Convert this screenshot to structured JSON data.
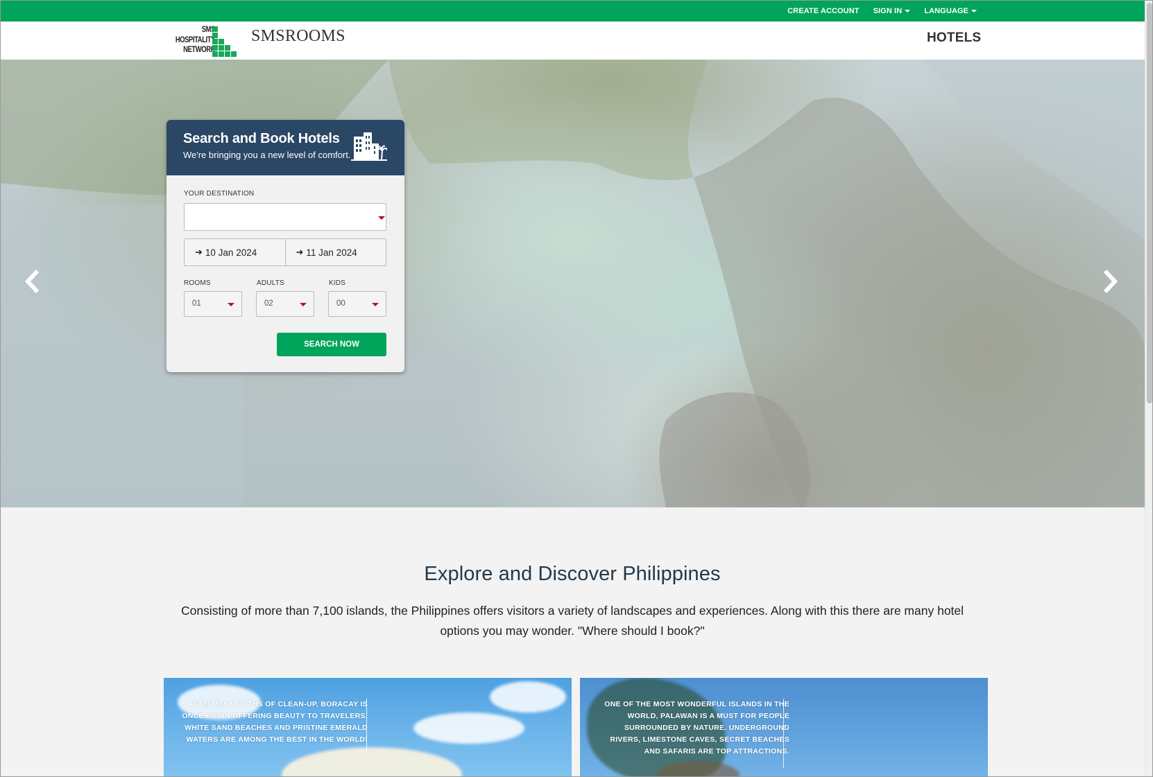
{
  "topbar": {
    "create_account": "CREATE ACCOUNT",
    "sign_in": "SIGN IN",
    "language": "LANGUAGE"
  },
  "header": {
    "logo_text": [
      "SMS",
      "HOSPITALITY",
      "NETWORK"
    ],
    "brand": "SMSROOMS",
    "nav_hotels": "HOTELS"
  },
  "booking": {
    "title": "Search and Book Hotels",
    "subtitle": "We're bringing you a new level of comfort.",
    "destination_label": "YOUR DESTINATION",
    "destination_value": "",
    "checkin": "10 Jan 2024",
    "checkout": "11 Jan 2024",
    "rooms_label": "ROOMS",
    "rooms_value": "01",
    "adults_label": "ADULTS",
    "adults_value": "02",
    "kids_label": "KIDS",
    "kids_value": "00",
    "search_label": "SEARCH NOW"
  },
  "explore": {
    "title": "Explore and Discover Philippines",
    "text": "Consisting of more than 7,100 islands, the Philippines offers visitors a variety of landscapes and experiences. Along with this there are many hotel options you may wonder. \"Where should I book?\""
  },
  "cards": [
    {
      "text": "AFTER SIX MONTHS OF CLEAN-UP, BORACAY IS ONCE AGAIN OFFERING BEAUTY TO TRAVELERS. WHITE SAND BEACHES AND PRISTINE EMERALD WATERS ARE AMONG THE BEST IN THE WORLD!"
    },
    {
      "text": "ONE OF THE MOST WONDERFUL ISLANDS IN THE WORLD, PALAWAN IS A MUST FOR PEOPLE SURROUNDED BY NATURE. UNDERGROUND RIVERS, LIMESTONE CAVES, SECRET BEACHES AND SAFARIS ARE TOP ATTRACTIONS."
    }
  ],
  "colors": {
    "brand_green": "#00a45a",
    "panel_navy": "#2b4766",
    "caret_red": "#b1121f"
  },
  "icons": [
    "caret-down-icon",
    "hotel-building-icon",
    "arrow-right-icon",
    "chevron-left-icon",
    "chevron-right-icon"
  ]
}
